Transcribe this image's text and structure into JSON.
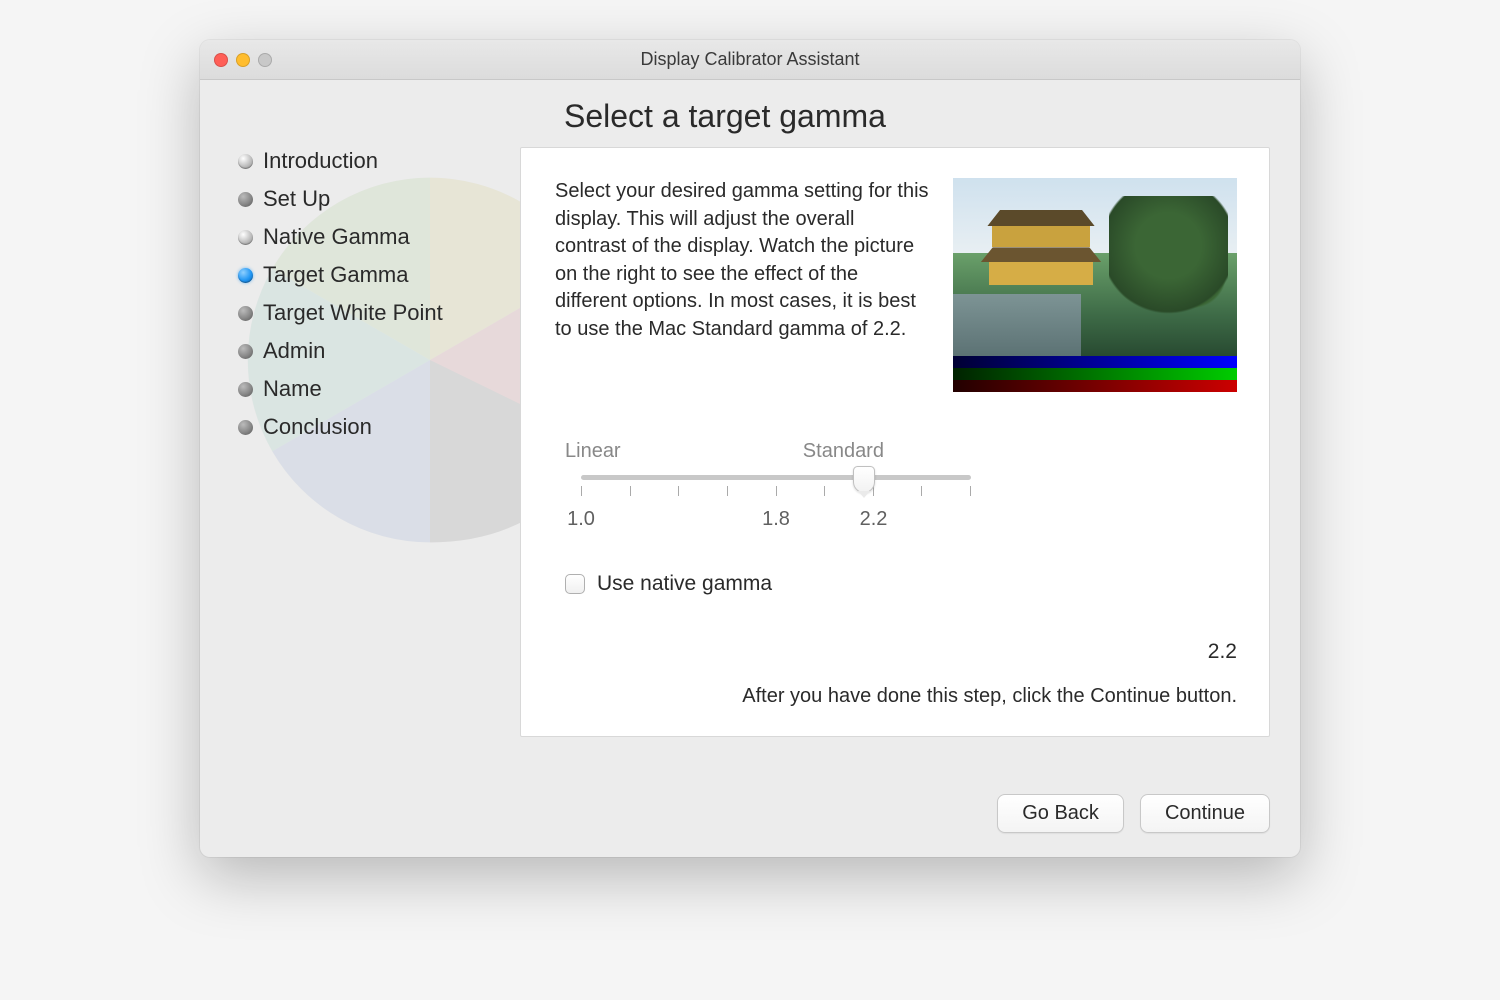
{
  "window": {
    "title": "Display Calibrator Assistant"
  },
  "sidebar": {
    "steps": [
      {
        "label": "Introduction",
        "state": "done"
      },
      {
        "label": "Set Up",
        "state": "pending"
      },
      {
        "label": "Native Gamma",
        "state": "done"
      },
      {
        "label": "Target Gamma",
        "state": "current"
      },
      {
        "label": "Target White Point",
        "state": "pending"
      },
      {
        "label": "Admin",
        "state": "pending"
      },
      {
        "label": "Name",
        "state": "pending"
      },
      {
        "label": "Conclusion",
        "state": "pending"
      }
    ]
  },
  "main": {
    "title": "Select a target gamma",
    "description": "Select your desired gamma setting for this display. This will adjust the overall contrast of the display.  Watch the picture on the right to see the effect of the different options.  In most cases, it is best to use the Mac Standard gamma of 2.2.",
    "slider": {
      "label_left": "Linear",
      "label_right": "Standard",
      "marks": {
        "min": "1.0",
        "mid": "1.8",
        "std": "2.2"
      },
      "value_percent": 72.5
    },
    "checkbox_label": "Use native gamma",
    "current_value": "2.2",
    "hint": "After you have done this step, click the Continue button."
  },
  "footer": {
    "back": "Go Back",
    "continue": "Continue"
  }
}
